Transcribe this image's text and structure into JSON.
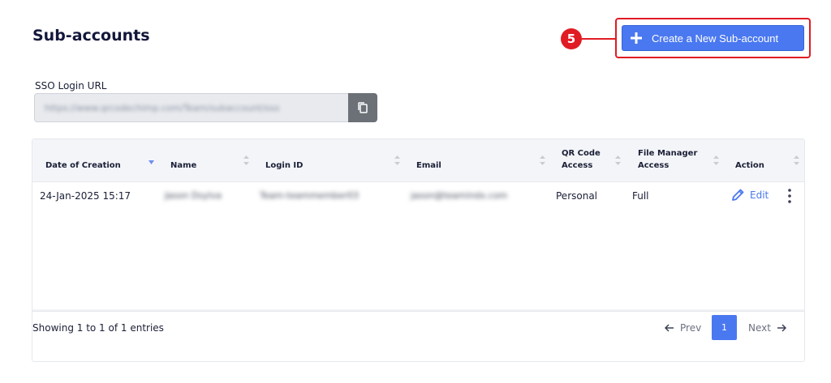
{
  "page": {
    "title": "Sub-accounts"
  },
  "callout": {
    "number": "5"
  },
  "create_button": {
    "label": "Create a New Sub-account",
    "icon": "plus-icon"
  },
  "sso": {
    "label": "SSO Login URL",
    "value": "https://www.qrcodechimp.com/Team/subaccount/sso",
    "copy_icon": "copy-icon"
  },
  "table": {
    "columns": [
      {
        "label": "Date of Creation",
        "sort": "desc"
      },
      {
        "label": "Name",
        "sort": "none"
      },
      {
        "label": "Login ID",
        "sort": "none"
      },
      {
        "label": "Email",
        "sort": "none"
      },
      {
        "label": "QR Code Access",
        "sort": "none"
      },
      {
        "label": "File Manager Access",
        "sort": "none"
      },
      {
        "label": "Action",
        "sort": "none"
      }
    ],
    "rows": [
      {
        "date": "24-Jan-2025 15:17",
        "name": "Jason Dsylva",
        "login_id": "Team-teammember03",
        "email": "jason@teamindx.com",
        "qr_access": "Personal",
        "file_access": "Full",
        "action": "Edit"
      }
    ]
  },
  "footer": {
    "entries": "Showing 1 to 1 of 1 entries",
    "prev": "Prev",
    "page": "1",
    "next": "Next"
  },
  "colors": {
    "accent": "#4a78f0",
    "callout": "#e01b24",
    "header_bg": "#f4f5f8"
  }
}
